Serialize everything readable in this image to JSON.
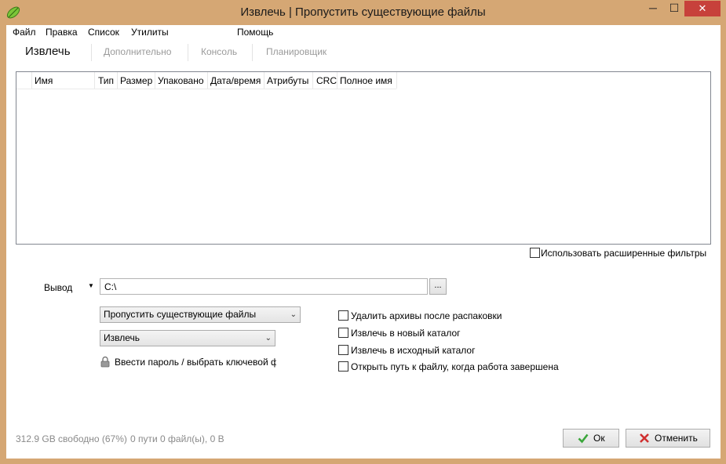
{
  "window": {
    "title": "Извлечь | Пропустить существующие файлы",
    "close_glyph": "✕",
    "minimize_glyph": "─",
    "maximize_glyph": "☐"
  },
  "menu": [
    "Файл",
    "Правка",
    "Список",
    "Утилиты",
    "Помощь"
  ],
  "tabs": [
    "Извлечь",
    "Дополнительно",
    "Консоль",
    "Планировщик"
  ],
  "file_list": {
    "columns": [
      "Имя",
      "Тип",
      "Размер",
      "Упаковано",
      "Дата/время",
      "Атрибуты",
      "CRC",
      "Полное имя"
    ]
  },
  "advanced_filters_label": "Использовать расширенные фильтры",
  "output": {
    "label": "Вывод",
    "path": "C:\\",
    "browse_label": "..."
  },
  "overwrite_select": "Пропустить существующие файлы",
  "action_select": "Извлечь",
  "password_label": "Ввести пароль / выбрать ключевой ф",
  "options": [
    "Удалить архивы после распаковки",
    "Извлечь в новый каталог",
    "Извлечь в исходный каталог",
    "Открыть путь к файлу, когда работа завершена"
  ],
  "status": {
    "free_space": "312.9 GB свободно (67%)",
    "summary": "0 пути 0 файл(ы), 0 B"
  },
  "buttons": {
    "ok": "Ок",
    "cancel": "Отменить"
  },
  "colors": {
    "titlebar": "#d5a774",
    "close": "#c7413b",
    "ok_check": "#3aa63a",
    "cancel_x": "#d03030"
  }
}
